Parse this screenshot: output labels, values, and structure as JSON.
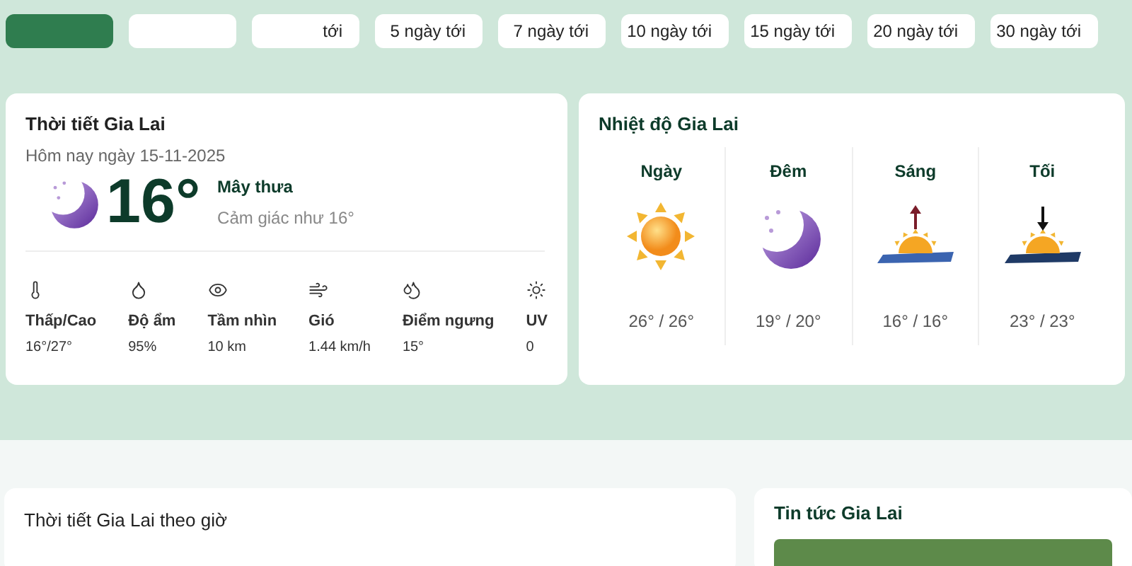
{
  "tabs": [
    {
      "selected": true
    },
    {
      "selected": false
    },
    {
      "label": "tới",
      "selected": false
    },
    {
      "label": "5 ngày tới",
      "selected": false
    },
    {
      "label": "7 ngày tới",
      "selected": false
    },
    {
      "label": "10 ngày tới",
      "selected": false
    },
    {
      "label": "15 ngày tới",
      "selected": false
    },
    {
      "label": "20 ngày tới",
      "selected": false
    },
    {
      "label": "30 ngày tới",
      "selected": false
    }
  ],
  "current": {
    "title": "Thời tiết Gia Lai",
    "date": "Hôm nay ngày 15-11-2025",
    "temperature": "16°",
    "condition": "Mây thưa",
    "feels_like": "Cảm giác như 16°",
    "stats": [
      {
        "kind": "thermometer",
        "label": "Thấp/Cao",
        "value": "16°/27°"
      },
      {
        "kind": "humidity",
        "label": "Độ ẩm",
        "value": "95%"
      },
      {
        "kind": "visibility",
        "label": "Tầm nhìn",
        "value": "10 km"
      },
      {
        "kind": "wind",
        "label": "Gió",
        "value": "1.44 km/h"
      },
      {
        "kind": "dewpoint",
        "label": "Điểm ngưng",
        "value": "15°"
      },
      {
        "kind": "uv",
        "label": "UV",
        "value": "0"
      }
    ]
  },
  "temperatures": {
    "title": "Nhiệt độ Gia Lai",
    "periods": [
      {
        "kind": "sun",
        "label": "Ngày",
        "value": "26° / 26°"
      },
      {
        "kind": "moon",
        "label": "Đêm",
        "value": "19° / 20°"
      },
      {
        "kind": "sunrise",
        "label": "Sáng",
        "value": "16° / 16°"
      },
      {
        "kind": "sunset",
        "label": "Tối",
        "value": "23° / 23°"
      }
    ]
  },
  "hourly": {
    "title": "Thời tiết Gia Lai theo giờ"
  },
  "news": {
    "title": "Tin tức Gia Lai"
  }
}
